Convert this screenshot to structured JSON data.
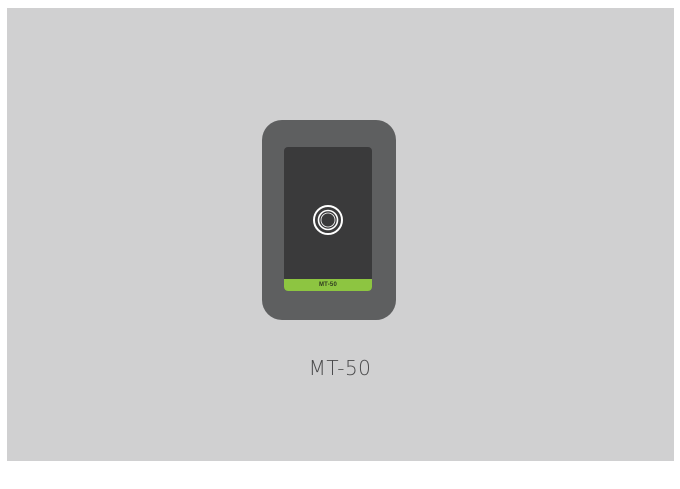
{
  "device": {
    "strip_label": "MT-50",
    "caption": "MT-50",
    "button_icon": "ring-button-icon",
    "colors": {
      "background": "#d0d0d1",
      "frame": "#5e5f60",
      "screen": "#3a3a3b",
      "strip": "#8dc541"
    }
  }
}
